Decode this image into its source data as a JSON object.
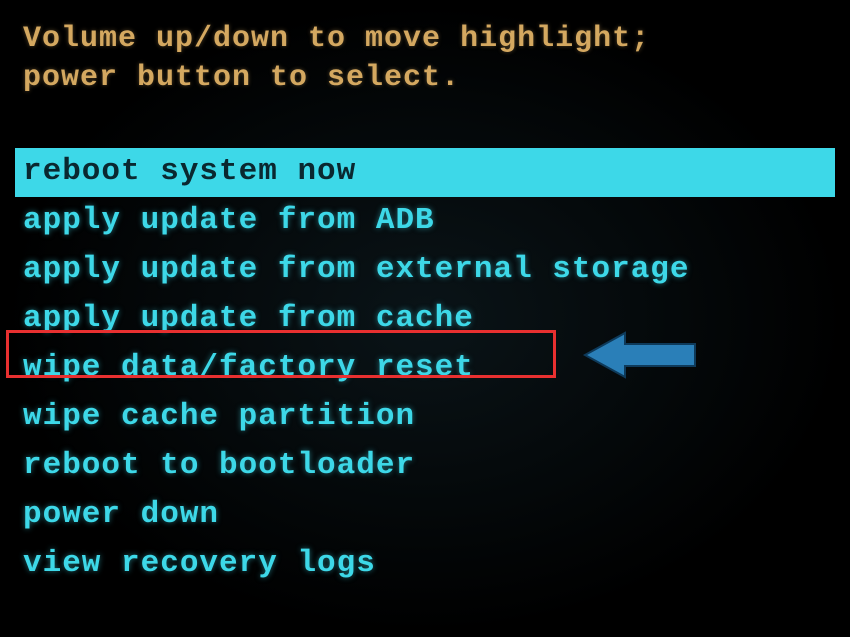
{
  "instructions": {
    "line1": "Volume up/down to move highlight;",
    "line2": "power button to select."
  },
  "menu": {
    "items": [
      {
        "label": "reboot system now",
        "selected": true,
        "highlighted": false
      },
      {
        "label": "apply update from ADB",
        "selected": false,
        "highlighted": false
      },
      {
        "label": "apply update from external storage",
        "selected": false,
        "highlighted": false
      },
      {
        "label": "apply update from cache",
        "selected": false,
        "highlighted": false
      },
      {
        "label": "wipe data/factory reset",
        "selected": false,
        "highlighted": true
      },
      {
        "label": "wipe cache partition",
        "selected": false,
        "highlighted": false
      },
      {
        "label": "reboot to bootloader",
        "selected": false,
        "highlighted": false
      },
      {
        "label": "power down",
        "selected": false,
        "highlighted": false
      },
      {
        "label": "view recovery logs",
        "selected": false,
        "highlighted": false
      }
    ]
  },
  "annotation": {
    "box_color": "#e83030",
    "arrow_color": "#2a7fb8",
    "arrow_border": "#0e3a5a"
  }
}
